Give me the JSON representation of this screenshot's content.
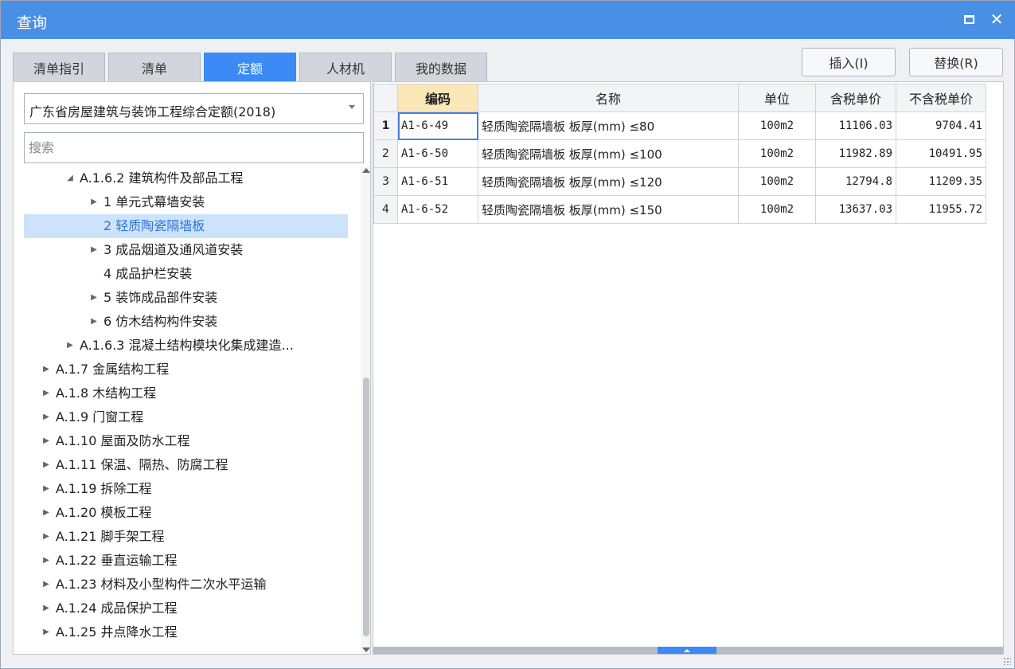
{
  "window": {
    "title": "查询"
  },
  "tabs": [
    {
      "label": "清单指引",
      "active": false
    },
    {
      "label": "清单",
      "active": false
    },
    {
      "label": "定额",
      "active": true
    },
    {
      "label": "人材机",
      "active": false
    },
    {
      "label": "我的数据",
      "active": false
    }
  ],
  "actions": {
    "insert_label": "插入(I)",
    "replace_label": "替换(R)"
  },
  "left": {
    "quota_library": "广东省房屋建筑与装饰工程综合定额(2018)",
    "search_placeholder": "搜索"
  },
  "tree": [
    {
      "label": "A.1.6.2 建筑构件及部品工程",
      "expander": "expanded"
    },
    {
      "label": "1 单元式幕墙安装",
      "expander": "collapsed"
    },
    {
      "label": "2 轻质陶瓷隔墙板",
      "expander": "none",
      "selected": true
    },
    {
      "label": "3 成品烟道及通风道安装",
      "expander": "collapsed"
    },
    {
      "label": "4 成品护栏安装",
      "expander": "none"
    },
    {
      "label": "5 装饰成品部件安装",
      "expander": "collapsed"
    },
    {
      "label": "6 仿木结构构件安装",
      "expander": "collapsed"
    },
    {
      "label": "A.1.6.3 混凝土结构模块化集成建造...",
      "expander": "collapsed"
    },
    {
      "label": "A.1.7 金属结构工程",
      "expander": "collapsed"
    },
    {
      "label": "A.1.8 木结构工程",
      "expander": "collapsed"
    },
    {
      "label": "A.1.9 门窗工程",
      "expander": "collapsed"
    },
    {
      "label": "A.1.10 屋面及防水工程",
      "expander": "collapsed"
    },
    {
      "label": "A.1.11 保温、隔热、防腐工程",
      "expander": "collapsed"
    },
    {
      "label": "A.1.19 拆除工程",
      "expander": "collapsed"
    },
    {
      "label": "A.1.20 模板工程",
      "expander": "collapsed"
    },
    {
      "label": "A.1.21 脚手架工程",
      "expander": "collapsed"
    },
    {
      "label": "A.1.22 垂直运输工程",
      "expander": "collapsed"
    },
    {
      "label": "A.1.23 材料及小型构件二次水平运输",
      "expander": "collapsed"
    },
    {
      "label": "A.1.24 成品保护工程",
      "expander": "collapsed"
    },
    {
      "label": "A.1.25 井点降水工程",
      "expander": "collapsed"
    }
  ],
  "table": {
    "headers": {
      "code": "编码",
      "name": "名称",
      "unit": "单位",
      "tax_price": "含税单价",
      "notax_price": "不含税单价"
    },
    "rows": [
      {
        "idx": "1",
        "code": "A1-6-49",
        "name": "轻质陶瓷隔墙板 板厚(mm) ≤80",
        "unit": "100m2",
        "tax_price": "11106.03",
        "notax_price": "9704.41"
      },
      {
        "idx": "2",
        "code": "A1-6-50",
        "name": "轻质陶瓷隔墙板 板厚(mm) ≤100",
        "unit": "100m2",
        "tax_price": "11982.89",
        "notax_price": "10491.95"
      },
      {
        "idx": "3",
        "code": "A1-6-51",
        "name": "轻质陶瓷隔墙板 板厚(mm) ≤120",
        "unit": "100m2",
        "tax_price": "12794.8",
        "notax_price": "11209.35"
      },
      {
        "idx": "4",
        "code": "A1-6-52",
        "name": "轻质陶瓷隔墙板 板厚(mm) ≤150",
        "unit": "100m2",
        "tax_price": "13637.03",
        "notax_price": "11955.72"
      }
    ]
  },
  "colors": {
    "title_bar": "#4a8fe6",
    "active_tab": "#3b8af5",
    "selected_row": "#cde3fb",
    "sorted_header": "#fbe7b8"
  }
}
